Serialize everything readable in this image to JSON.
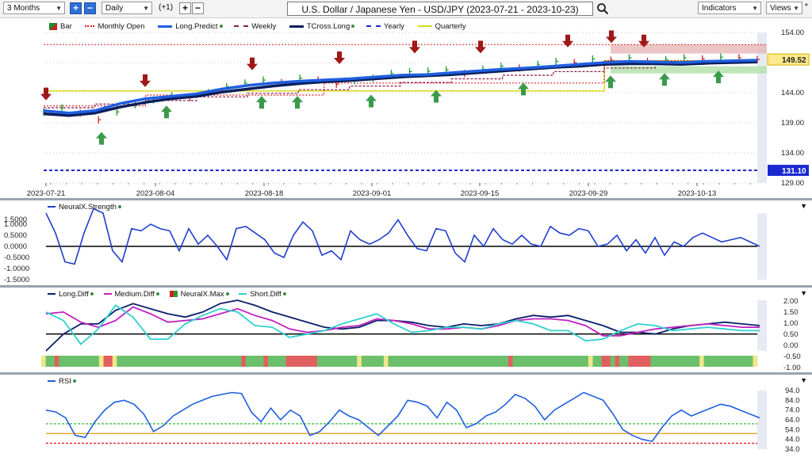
{
  "toolbar": {
    "period": "3 Months",
    "interval": "Daily",
    "offset": "(+1)",
    "title": "U.S. Dollar / Japanese Yen - USD/JPY (2023-07-21 - 2023-10-23)",
    "indicators": "Indicators",
    "views": "Views",
    "star": "*"
  },
  "main_legend": [
    {
      "label": "Bar",
      "color": "#1a8c2a",
      "style": "bar"
    },
    {
      "label": "Monthly Open",
      "color": "#e02020",
      "style": "dotted"
    },
    {
      "label": "Long.Predict",
      "color": "#1f5fe0",
      "style": "thick"
    },
    {
      "label": "Weekly",
      "color": "#8a1a4a",
      "style": "dashed"
    },
    {
      "label": "TCross.Long",
      "color": "#0a1e5a",
      "style": "thick"
    },
    {
      "label": "Yearly",
      "color": "#1a2ad0",
      "style": "dashed"
    },
    {
      "label": "Quarterly",
      "color": "#d8d820",
      "style": "solid"
    }
  ],
  "price_axis": [
    "154.00",
    "149.00",
    "144.00",
    "139.00",
    "134.00",
    "129.00"
  ],
  "current_price_tag": "149.52",
  "yearly_price_tag": "131.10",
  "date_labels": [
    "2023-07-21",
    "2023-08-04",
    "2023-08-18",
    "2023-09-01",
    "2023-09-15",
    "2023-09-29",
    "2023-10-13"
  ],
  "panel_strength": {
    "title": "NeuralX.Strength",
    "axis": [
      "1.5000",
      "1.0000",
      "0.5000",
      "0.0000",
      "-0.5000",
      "-1.0000",
      "-1.5000"
    ]
  },
  "panel_diff": {
    "legend": [
      "Long.Diff",
      "Medium.Diff",
      "NeuralX.Max",
      "Short.Diff"
    ],
    "axis": [
      "2.00",
      "1.50",
      "1.00",
      "0.50",
      "0.00",
      "-0.50",
      "-1.00"
    ]
  },
  "panel_rsi": {
    "title": "RSI",
    "axis": [
      "94.0",
      "84.0",
      "74.0",
      "64.0",
      "54.0",
      "44.0",
      "34.0"
    ]
  },
  "chart_data": [
    {
      "type": "line",
      "title": "U.S. Dollar / Japanese Yen - USD/JPY (2023-07-21 - 2023-10-23)",
      "ylim": [
        129,
        154
      ],
      "x": [
        "2023-07-21",
        "2023-10-23"
      ],
      "series": [
        {
          "name": "Long.Predict",
          "values": [
            141.0,
            140.6,
            141.0,
            142.2,
            143.0,
            143.4,
            143.8,
            144.6,
            145.2,
            145.6,
            145.9,
            146.1,
            146.3,
            146.6,
            146.9,
            147.0,
            147.3,
            147.6,
            147.9,
            148.1,
            148.4,
            148.7,
            149.0,
            149.2,
            149.1,
            149.0,
            149.2,
            149.3,
            149.4
          ]
        },
        {
          "name": "TCross.Long",
          "values": [
            140.5,
            140.2,
            140.6,
            141.6,
            142.4,
            143.0,
            143.4,
            144.1,
            144.6,
            145.1,
            145.5,
            145.8,
            146.0,
            146.3,
            146.6,
            146.8,
            147.0,
            147.3,
            147.6,
            147.9,
            148.2,
            148.4,
            148.7,
            148.8,
            148.8,
            148.7,
            148.9,
            149.0,
            149.1
          ]
        },
        {
          "name": "Yearly",
          "values": [
            131.1
          ]
        },
        {
          "name": "Monthly Open",
          "values": [
            141.8,
            141.8,
            141.8,
            141.8,
            143.6,
            143.6,
            143.6,
            143.6,
            143.6,
            143.6,
            143.6,
            145.6,
            145.6,
            145.6,
            145.6,
            145.6,
            145.6,
            145.6,
            145.6,
            145.6,
            145.6,
            145.6,
            149.3,
            149.3,
            149.3,
            149.3,
            149.3,
            149.3,
            149.3
          ]
        },
        {
          "name": "Quarterly",
          "values": [
            144.3,
            144.3,
            144.3,
            144.3,
            144.3,
            144.3,
            144.3,
            144.3,
            144.3,
            144.3,
            144.3,
            144.3,
            144.3,
            144.3,
            144.3,
            144.3,
            144.3,
            144.3,
            144.3,
            144.3,
            144.3,
            144.3,
            149.3,
            149.3,
            149.3,
            149.3,
            149.3,
            149.3,
            149.3
          ]
        }
      ],
      "current": 149.52
    },
    {
      "type": "line",
      "ylim": [
        -1.5,
        1.5
      ],
      "series": [
        {
          "name": "NeuralX.Strength",
          "values": [
            1.5,
            0.6,
            -0.7,
            -0.8,
            0.6,
            1.7,
            1.5,
            -0.2,
            -0.7,
            0.8,
            0.7,
            1.0,
            0.8,
            0.7,
            -0.2,
            0.8,
            0.1,
            0.5,
            0.0,
            -0.6,
            0.8,
            0.9,
            0.6,
            0.3,
            -0.3,
            -0.5,
            0.5,
            1.1,
            0.7,
            -0.4,
            -0.2,
            -0.6,
            0.7,
            0.3,
            0.1,
            0.3,
            0.6,
            1.2,
            0.5,
            -0.1,
            -0.2,
            0.8,
            0.7,
            -0.3,
            -0.7,
            0.5,
            0.0,
            0.8,
            0.3,
            0.1,
            0.5,
            0.1,
            0.0,
            0.9,
            0.6,
            0.5,
            0.8,
            0.7,
            0.0,
            0.1,
            0.5,
            -0.2,
            0.3,
            -0.3,
            0.4,
            -0.4,
            0.2,
            0.0,
            0.4,
            0.6,
            0.4,
            0.2,
            0.3,
            0.4,
            0.2,
            0.0
          ]
        }
      ]
    },
    {
      "type": "line",
      "ylim": [
        -1.0,
        2.0
      ],
      "series": [
        {
          "name": "Long.Diff",
          "values": [
            -1.0,
            0.0,
            0.6,
            0.6,
            1.4,
            1.8,
            1.5,
            1.2,
            1.0,
            1.3,
            1.8,
            2.0,
            1.7,
            1.3,
            1.0,
            0.7,
            0.4,
            0.3,
            0.4,
            0.8,
            0.8,
            0.7,
            0.5,
            0.4,
            0.6,
            0.5,
            0.6,
            0.9,
            1.1,
            1.0,
            1.1,
            0.8,
            0.5,
            0.1,
            0.1,
            0.0,
            0.3,
            0.5,
            0.6,
            0.7,
            0.6,
            0.5
          ]
        },
        {
          "name": "Medium.Diff",
          "values": [
            1.2,
            1.3,
            0.7,
            0.4,
            0.8,
            1.6,
            1.2,
            0.7,
            0.8,
            0.9,
            1.2,
            1.5,
            1.1,
            0.8,
            0.3,
            0.1,
            0.2,
            0.4,
            0.5,
            0.9,
            0.8,
            0.6,
            0.3,
            0.3,
            0.4,
            0.3,
            0.5,
            0.8,
            0.9,
            0.9,
            0.8,
            0.5,
            -0.1,
            -0.1,
            0.1,
            0.3,
            0.4,
            0.5,
            0.6,
            0.5,
            0.4,
            0.4
          ]
        },
        {
          "name": "Short.Diff",
          "values": [
            1.3,
            0.8,
            -0.6,
            0.3,
            1.7,
            1.0,
            -0.3,
            -0.3,
            0.6,
            1.1,
            1.5,
            1.3,
            0.5,
            0.4,
            -0.2,
            0.0,
            0.2,
            0.6,
            0.9,
            1.2,
            0.6,
            0.1,
            0.2,
            0.4,
            0.4,
            0.3,
            0.6,
            0.8,
            0.6,
            0.2,
            0.2,
            -0.4,
            -0.3,
            0.2,
            0.6,
            0.5,
            0.2,
            0.3,
            0.4,
            0.3,
            0.2,
            0.2
          ]
        }
      ]
    },
    {
      "type": "line",
      "ylim": [
        34,
        94
      ],
      "series": [
        {
          "name": "RSI",
          "values": [
            74,
            72,
            66,
            48,
            46,
            62,
            74,
            82,
            84,
            80,
            70,
            52,
            58,
            68,
            74,
            80,
            84,
            88,
            90,
            92,
            91,
            72,
            62,
            76,
            64,
            74,
            68,
            48,
            52,
            62,
            74,
            68,
            64,
            56,
            48,
            58,
            68,
            84,
            82,
            78,
            66,
            82,
            74,
            56,
            60,
            68,
            72,
            80,
            90,
            86,
            78,
            64,
            74,
            80,
            86,
            92,
            88,
            84,
            70,
            54,
            48,
            44,
            42,
            56,
            68,
            74,
            68,
            72,
            76,
            80,
            78,
            74,
            70,
            66
          ]
        }
      ],
      "levels": [
        60,
        50,
        40
      ]
    }
  ]
}
